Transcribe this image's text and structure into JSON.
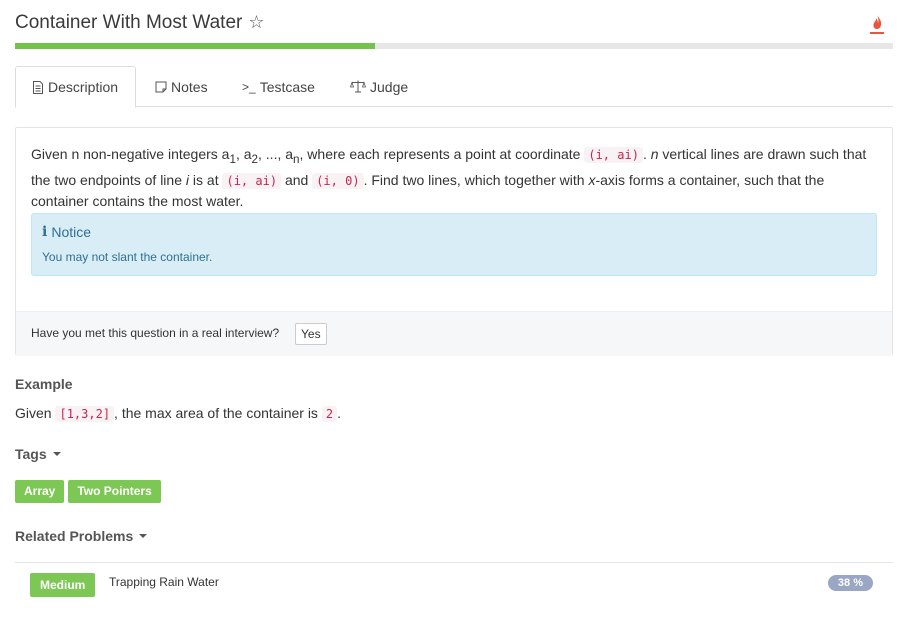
{
  "problem": {
    "title": "Container With Most Water",
    "progress_percent": 41
  },
  "tabs": [
    {
      "label": "Description",
      "icon": "document-icon",
      "active": true
    },
    {
      "label": "Notes",
      "icon": "note-icon",
      "active": false
    },
    {
      "label": "Testcase",
      "icon": "terminal-icon",
      "active": false
    },
    {
      "label": "Judge",
      "icon": "scale-icon",
      "active": false
    }
  ],
  "description": {
    "p1": "Given n non-negative integers a",
    "sub1": "1",
    "sep1": ", a",
    "sub2": "2",
    "sep2": ", ..., a",
    "subn": "n",
    "p2": ", where each represents a point at coordinate ",
    "code1": "(i, ai)",
    "p3": ". ",
    "em1": "n",
    "p4": " vertical lines are drawn such that the two endpoints of line ",
    "em2": "i",
    "p5": " is at ",
    "code2": "(i, ai)",
    "p6": " and ",
    "code3": "(i, 0)",
    "p7": ". Find two lines, which together with ",
    "em3": "x",
    "p8": "-axis forms a container, such that the container contains the most water."
  },
  "notice": {
    "title": "Notice",
    "text": "You may not slant the container."
  },
  "interview": {
    "question": "Have you met this question in a real interview?",
    "yes_label": "Yes"
  },
  "example": {
    "heading": "Example",
    "pre": "Given ",
    "code1": "[1,3,2]",
    "mid": ", the max area of the container is ",
    "code2": "2",
    "post": "."
  },
  "tags": {
    "heading": "Tags",
    "items": [
      "Array",
      "Two Pointers"
    ]
  },
  "related": {
    "heading": "Related Problems",
    "items": [
      {
        "difficulty": "Medium",
        "title": "Trapping Rain Water",
        "percent": "38 %"
      }
    ]
  },
  "colors": {
    "accent_green": "#7dc755",
    "progress_green": "#73c24a",
    "flame": "#e8563f",
    "notice_bg": "#d9edf7",
    "code_red": "#c7254e"
  }
}
